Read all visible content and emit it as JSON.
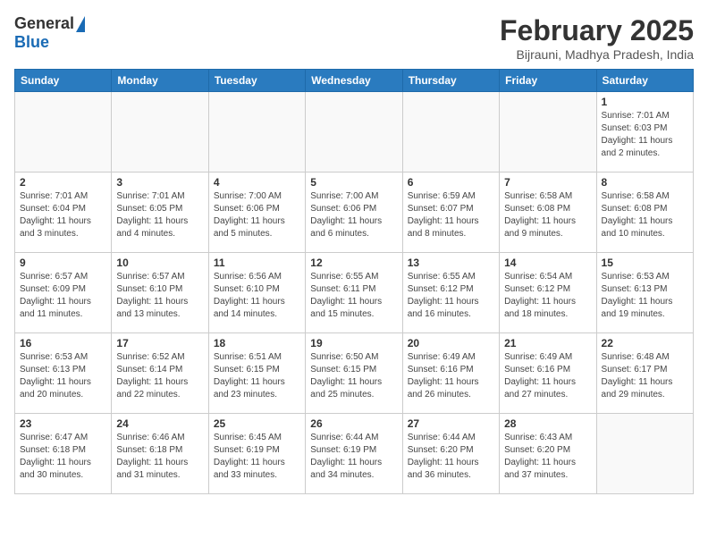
{
  "header": {
    "logo_general": "General",
    "logo_blue": "Blue",
    "month_title": "February 2025",
    "location": "Bijrauni, Madhya Pradesh, India"
  },
  "days_of_week": [
    "Sunday",
    "Monday",
    "Tuesday",
    "Wednesday",
    "Thursday",
    "Friday",
    "Saturday"
  ],
  "weeks": [
    [
      {
        "num": "",
        "info": ""
      },
      {
        "num": "",
        "info": ""
      },
      {
        "num": "",
        "info": ""
      },
      {
        "num": "",
        "info": ""
      },
      {
        "num": "",
        "info": ""
      },
      {
        "num": "",
        "info": ""
      },
      {
        "num": "1",
        "info": "Sunrise: 7:01 AM\nSunset: 6:03 PM\nDaylight: 11 hours\nand 2 minutes."
      }
    ],
    [
      {
        "num": "2",
        "info": "Sunrise: 7:01 AM\nSunset: 6:04 PM\nDaylight: 11 hours\nand 3 minutes."
      },
      {
        "num": "3",
        "info": "Sunrise: 7:01 AM\nSunset: 6:05 PM\nDaylight: 11 hours\nand 4 minutes."
      },
      {
        "num": "4",
        "info": "Sunrise: 7:00 AM\nSunset: 6:06 PM\nDaylight: 11 hours\nand 5 minutes."
      },
      {
        "num": "5",
        "info": "Sunrise: 7:00 AM\nSunset: 6:06 PM\nDaylight: 11 hours\nand 6 minutes."
      },
      {
        "num": "6",
        "info": "Sunrise: 6:59 AM\nSunset: 6:07 PM\nDaylight: 11 hours\nand 8 minutes."
      },
      {
        "num": "7",
        "info": "Sunrise: 6:58 AM\nSunset: 6:08 PM\nDaylight: 11 hours\nand 9 minutes."
      },
      {
        "num": "8",
        "info": "Sunrise: 6:58 AM\nSunset: 6:08 PM\nDaylight: 11 hours\nand 10 minutes."
      }
    ],
    [
      {
        "num": "9",
        "info": "Sunrise: 6:57 AM\nSunset: 6:09 PM\nDaylight: 11 hours\nand 11 minutes."
      },
      {
        "num": "10",
        "info": "Sunrise: 6:57 AM\nSunset: 6:10 PM\nDaylight: 11 hours\nand 13 minutes."
      },
      {
        "num": "11",
        "info": "Sunrise: 6:56 AM\nSunset: 6:10 PM\nDaylight: 11 hours\nand 14 minutes."
      },
      {
        "num": "12",
        "info": "Sunrise: 6:55 AM\nSunset: 6:11 PM\nDaylight: 11 hours\nand 15 minutes."
      },
      {
        "num": "13",
        "info": "Sunrise: 6:55 AM\nSunset: 6:12 PM\nDaylight: 11 hours\nand 16 minutes."
      },
      {
        "num": "14",
        "info": "Sunrise: 6:54 AM\nSunset: 6:12 PM\nDaylight: 11 hours\nand 18 minutes."
      },
      {
        "num": "15",
        "info": "Sunrise: 6:53 AM\nSunset: 6:13 PM\nDaylight: 11 hours\nand 19 minutes."
      }
    ],
    [
      {
        "num": "16",
        "info": "Sunrise: 6:53 AM\nSunset: 6:13 PM\nDaylight: 11 hours\nand 20 minutes."
      },
      {
        "num": "17",
        "info": "Sunrise: 6:52 AM\nSunset: 6:14 PM\nDaylight: 11 hours\nand 22 minutes."
      },
      {
        "num": "18",
        "info": "Sunrise: 6:51 AM\nSunset: 6:15 PM\nDaylight: 11 hours\nand 23 minutes."
      },
      {
        "num": "19",
        "info": "Sunrise: 6:50 AM\nSunset: 6:15 PM\nDaylight: 11 hours\nand 25 minutes."
      },
      {
        "num": "20",
        "info": "Sunrise: 6:49 AM\nSunset: 6:16 PM\nDaylight: 11 hours\nand 26 minutes."
      },
      {
        "num": "21",
        "info": "Sunrise: 6:49 AM\nSunset: 6:16 PM\nDaylight: 11 hours\nand 27 minutes."
      },
      {
        "num": "22",
        "info": "Sunrise: 6:48 AM\nSunset: 6:17 PM\nDaylight: 11 hours\nand 29 minutes."
      }
    ],
    [
      {
        "num": "23",
        "info": "Sunrise: 6:47 AM\nSunset: 6:18 PM\nDaylight: 11 hours\nand 30 minutes."
      },
      {
        "num": "24",
        "info": "Sunrise: 6:46 AM\nSunset: 6:18 PM\nDaylight: 11 hours\nand 31 minutes."
      },
      {
        "num": "25",
        "info": "Sunrise: 6:45 AM\nSunset: 6:19 PM\nDaylight: 11 hours\nand 33 minutes."
      },
      {
        "num": "26",
        "info": "Sunrise: 6:44 AM\nSunset: 6:19 PM\nDaylight: 11 hours\nand 34 minutes."
      },
      {
        "num": "27",
        "info": "Sunrise: 6:44 AM\nSunset: 6:20 PM\nDaylight: 11 hours\nand 36 minutes."
      },
      {
        "num": "28",
        "info": "Sunrise: 6:43 AM\nSunset: 6:20 PM\nDaylight: 11 hours\nand 37 minutes."
      },
      {
        "num": "",
        "info": ""
      }
    ]
  ]
}
